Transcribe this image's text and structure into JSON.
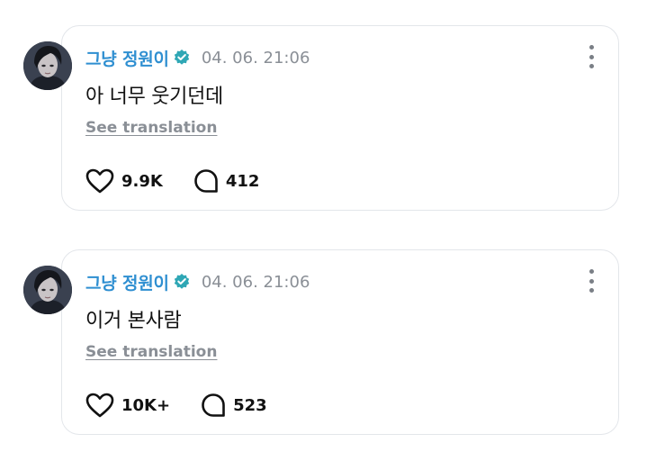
{
  "colors": {
    "username": "#2f8fd1",
    "verified": "#2fa7b5",
    "meta_text": "#8a8f96",
    "card_border": "#e3e6ea",
    "text": "#111111"
  },
  "posts": [
    {
      "username": "그냥 정원이",
      "verified_icon": "verified-badge-icon",
      "timestamp": "04. 06. 21:06",
      "text": "아 너무 웃기던데",
      "translate_label": "See translation",
      "likes": "9.9K",
      "comments": "412"
    },
    {
      "username": "그냥 정원이",
      "verified_icon": "verified-badge-icon",
      "timestamp": "04. 06. 21:06",
      "text": "이거 본사람",
      "translate_label": "See translation",
      "likes": "10K+",
      "comments": "523"
    }
  ]
}
